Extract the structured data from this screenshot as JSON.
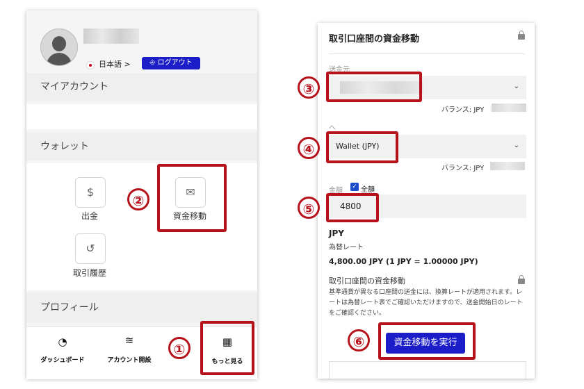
{
  "left": {
    "language_label": "日本語 >",
    "logout_label": "ログアウト",
    "my_account_heading": "マイアカウント",
    "wallet_heading": "ウォレット",
    "withdraw_label": "出金",
    "transfer_label": "資金移動",
    "history_label": "取引履歴",
    "profile_heading": "プロフィール",
    "nav": {
      "dashboard_label": "ダッシュボード",
      "open_account_label": "アカウント開設",
      "more_label": "もっと見る"
    }
  },
  "right": {
    "title": "取引口座間の資金移動",
    "from_label": "送金元",
    "balance_label_1": "バランス: JPY",
    "to_label": "へ",
    "to_value": "Wallet (JPY)",
    "balance_label_2": "バランス: JPY",
    "amount_label": "金額",
    "all_amount_label": "全額",
    "amount_value": "4800",
    "currency": "JPY",
    "rate_label": "為替レート",
    "rate_value": "4,800.00 JPY (1 JPY = 1.00000 JPY)",
    "notice_title": "取引口座間の資金移動",
    "notice_text": "基準通貨が異なる口座間の送金には、換算レートが適用されます。レートは為替レート表でご確認いただけますので、送金開始日のレートをご確認ください。",
    "execute_label": "資金移動を実行"
  },
  "annotations": {
    "step1": "①",
    "step2": "②",
    "step3": "③",
    "step4": "④",
    "step5": "⑤",
    "step6": "⑥"
  },
  "colors": {
    "brand_blue": "#1b1ec8",
    "annotation_red": "#b5121b"
  },
  "icons": {
    "avatar": "user-silhouette",
    "withdraw": "hand-coin-icon",
    "transfer": "money-envelope-icon",
    "history": "history-icon",
    "dashboard": "speedometer-icon",
    "open_account": "layers-plus-icon",
    "more": "grid-icon",
    "lock": "lock-icon"
  }
}
